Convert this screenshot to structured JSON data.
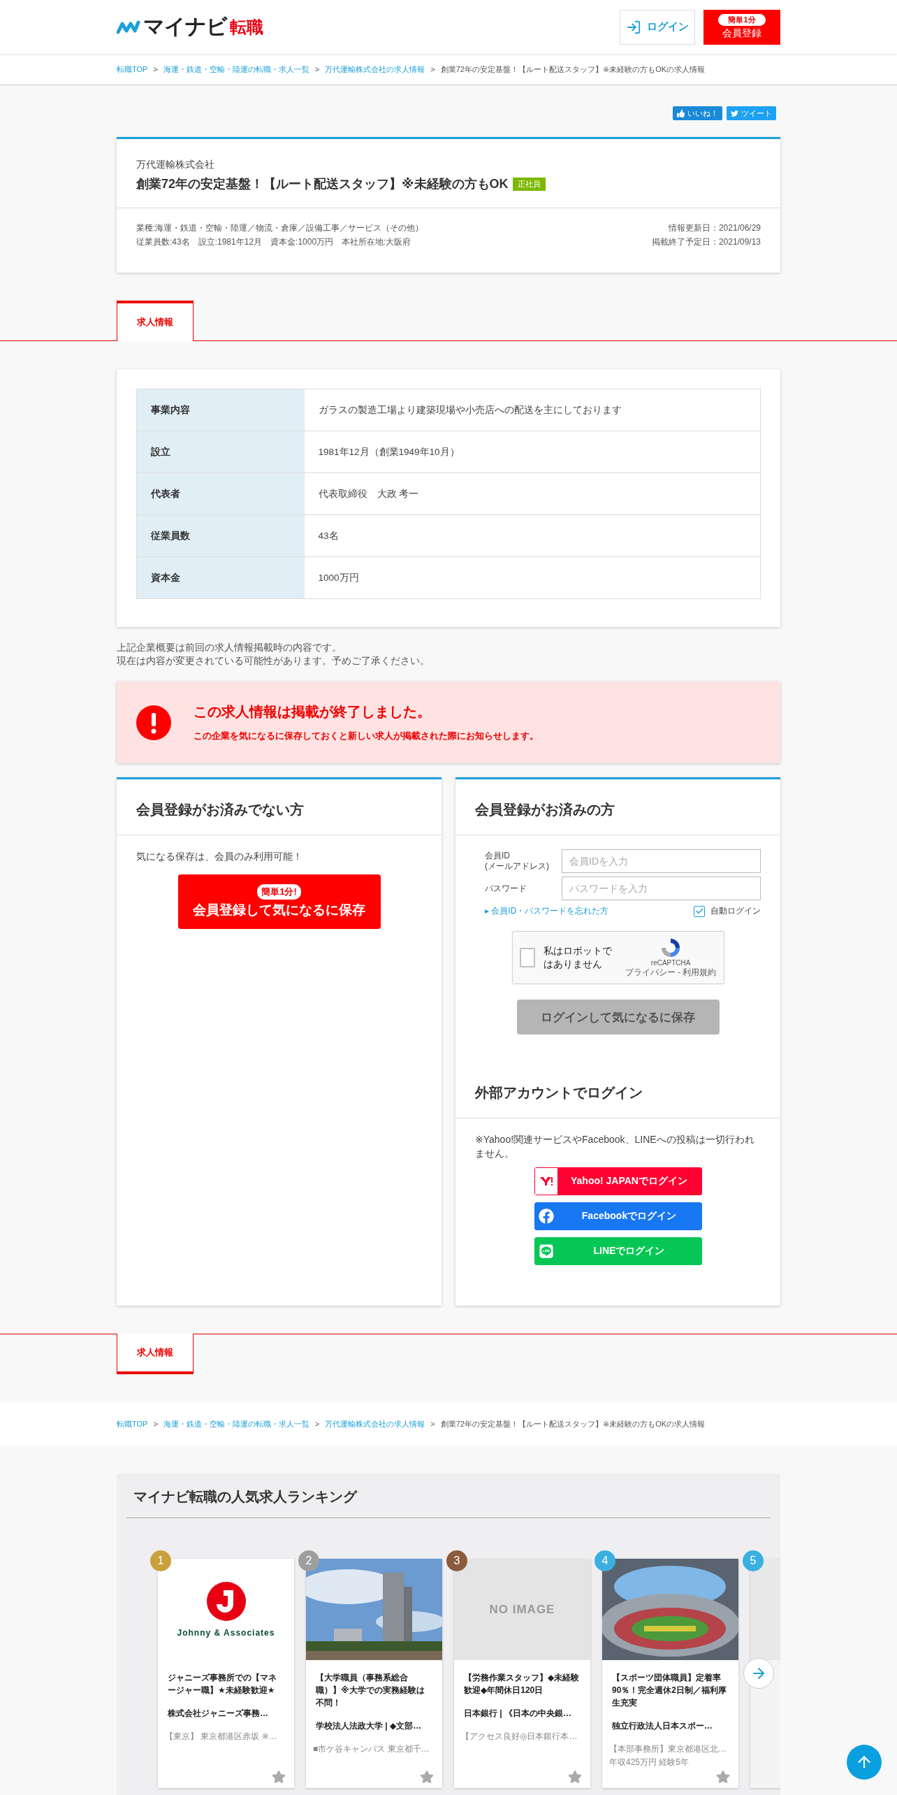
{
  "header": {
    "logo_main": "マイナビ",
    "logo_sub": "転職",
    "login": "ログイン",
    "register_badge": "簡単1分",
    "register": "会員登録"
  },
  "breadcrumb": [
    {
      "label": "転職TOP",
      "link": true
    },
    {
      "separator": ">",
      "label": "海運・鉄道・空輸・陸運の転職・求人一覧",
      "link": true
    },
    {
      "separator": ">",
      "label": "万代運輸株式会社の求人情報",
      "link": true
    },
    {
      "separator": ">",
      "label": "創業72年の安定基盤！【ルート配送スタッフ】※未経験の方もOKの求人情報",
      "link": false
    }
  ],
  "social": {
    "like": "いいね！",
    "tweet": "ツイート"
  },
  "job": {
    "company": "万代運輸株式会社",
    "title": "創業72年の安定基盤！【ルート配送スタッフ】※未経験の方もOK",
    "tag": "正社員",
    "meta": [
      "業種:海運・鉄道・空輸・陸運／物流・倉庫／設備工事／サービス（その他）",
      "従業員数:43名　設立:1981年12月　資本金:1000万円　本社所在地:大阪府"
    ],
    "dates": [
      "情報更新日：2021/06/29",
      "掲載終了予定日：2021/09/13"
    ]
  },
  "tab": {
    "label": "求人情報",
    "selected": true
  },
  "company_table": [
    {
      "label": "事業内容",
      "value": "ガラスの製造工場より建築現場や小売店への配送を主にしております"
    },
    {
      "label": "設立",
      "value": "1981年12月（創業1949年10月）"
    },
    {
      "label": "代表者",
      "value": "代表取締役　大政 考一"
    },
    {
      "label": "従業員数",
      "value": "43名"
    },
    {
      "label": "資本金",
      "value": "1000万円"
    }
  ],
  "notes": [
    "上記企業概要は前回の求人情報掲載時の内容です。",
    "現在は内容が変更されている可能性があります。予めご了承ください。"
  ],
  "notice": {
    "title": "この求人情報は掲載が終了しました。",
    "body": "この企業を気になるに保存しておくと新しい求人が掲載された際にお知らせします。"
  },
  "guest": {
    "title": "会員登録がお済みでない方",
    "text": "気になる保存は、会員のみ利用可能！",
    "badge": "簡単1分!",
    "button": "会員登録して気になるに保存"
  },
  "member": {
    "title": "会員登録がお済みの方",
    "id_label": [
      "会員ID",
      "(メールアドレス)"
    ],
    "id_placeholder": "会員IDを入力",
    "password_label": "パスワード",
    "password_placeholder": "パスワードを入力",
    "forgot": "▸ 会員ID・パスワードを忘れた方",
    "auto_login": {
      "label": "自動ログイン",
      "checked": true
    },
    "captcha": {
      "label": "私はロボットではありません",
      "brand": "reCAPTCHA",
      "links": "プライバシー - 利用規約",
      "checked": false
    },
    "submit": {
      "label": "ログインして気になるに保存",
      "disabled": true
    }
  },
  "external": {
    "title": "外部アカウントでログイン",
    "note": "※Yahoo!関連サービスやFacebook、LINEへの投稿は一切行われません。",
    "buttons": [
      {
        "kind": "yahoo",
        "label": "Yahoo! JAPANでログイン"
      },
      {
        "kind": "facebook",
        "label": "Facebookでログイン"
      },
      {
        "kind": "line",
        "label": "LINEでログイン"
      }
    ]
  },
  "bottom_tab": {
    "label": "求人情報",
    "selected": true
  },
  "bottom_breadcrumb": [
    {
      "label": "転職TOP",
      "link": true
    },
    {
      "separator": ">",
      "label": "海運・鉄道・空輸・陸運の転職・求人一覧",
      "link": true
    },
    {
      "separator": ">",
      "label": "万代運輸株式会社の求人情報",
      "link": true
    },
    {
      "separator": ">",
      "label": "創業72年の安定基盤！【ルート配送スタッフ】※未経験の方もOKの求人情報",
      "link": false
    }
  ],
  "ranking": {
    "title": "マイナビ転職の人気求人ランキング",
    "cards": [
      {
        "rank": "1",
        "color": "#c9a13b",
        "kind": "logo",
        "logo_text": "Johnny & Associates",
        "title": "ジャニーズ事務所での【マネージャー職】★未経験歓迎★",
        "company": "株式会社ジャニーズ事務…",
        "details": [
          "【東京】 東京都港区赤坂 ※…"
        ]
      },
      {
        "rank": "2",
        "color": "#9e9e9e",
        "kind": "building",
        "title": "【大学職員（事務系総合職）】※大学での実務経験は不問！",
        "company": "学校法人法政大学 | ◆文部…",
        "details": [
          "■市ケ谷キャンパス 東京都千…"
        ]
      },
      {
        "rank": "3",
        "color": "#8c5a3c",
        "kind": "none",
        "image_text": "NO IMAGE",
        "title": "【労務作業スタッフ】◆未経験歓迎◆年間休日120日",
        "company": "日本銀行 | 《日本の中央銀…",
        "details": [
          "【アクセス良好◎日本銀行本…"
        ]
      },
      {
        "rank": "4",
        "color": "#3bb0e0",
        "kind": "stadium",
        "title": "【スポーツ団体職員】定着率90％！完全週休2日制／福利厚生充実",
        "company": "独立行政法人日本スポー…",
        "details": [
          "【本部事務所】東京都港区北…",
          "年収425万円 経験5年"
        ]
      },
      {
        "rank": "5",
        "color": "#3bb0e0",
        "kind": "hidden"
      }
    ]
  }
}
